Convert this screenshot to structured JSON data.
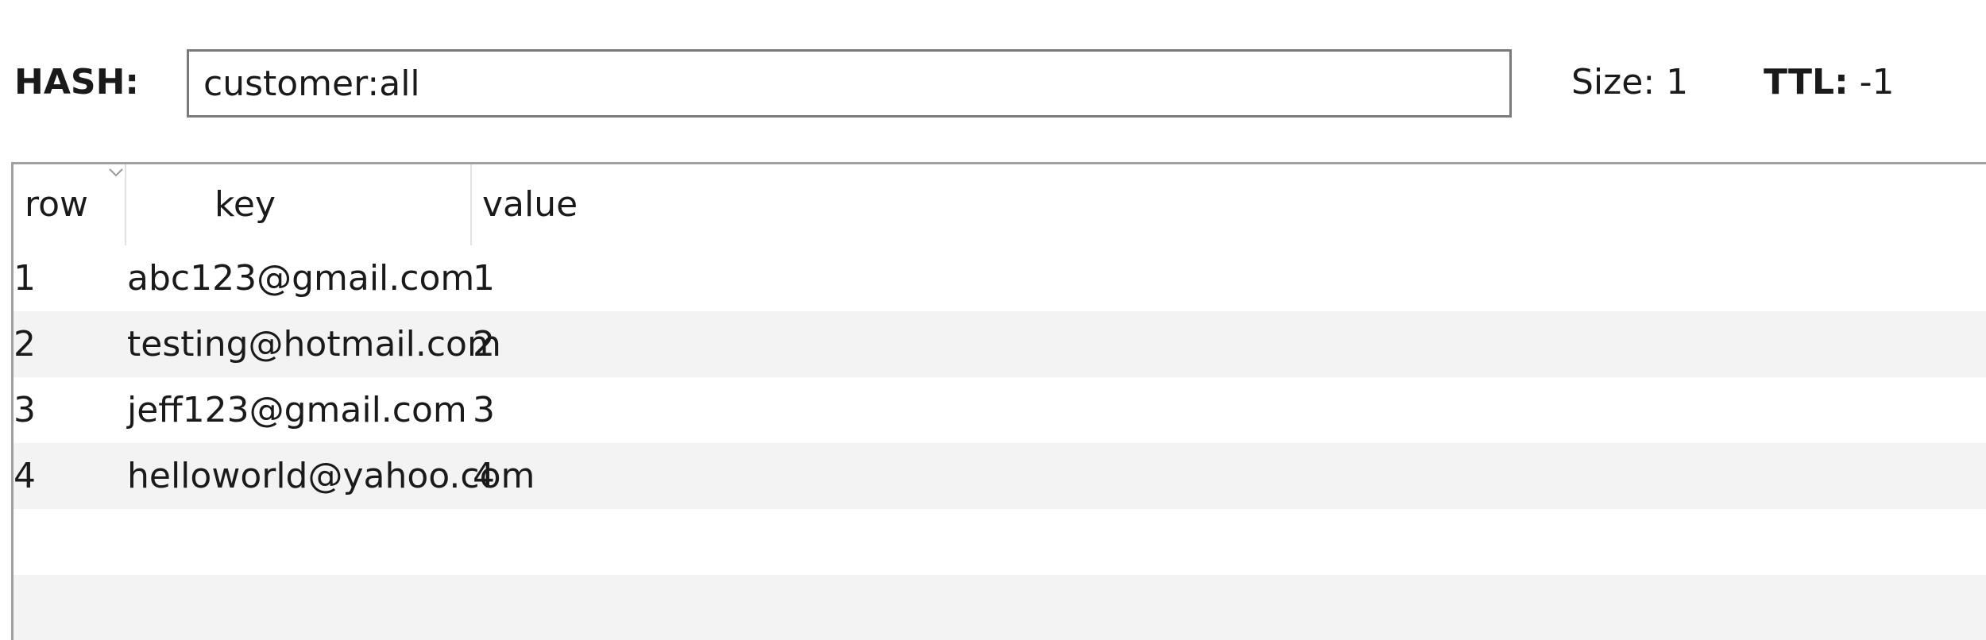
{
  "header": {
    "hash_label": "HASH:",
    "hash_value": "customer:all",
    "size_label": "Size: 1",
    "ttl_label": "TTL:",
    "ttl_value": "-1"
  },
  "table": {
    "columns": [
      "row",
      "key",
      "value"
    ],
    "sort_icon": "chevron-down-icon",
    "rows": [
      {
        "row": "1",
        "key": "abc123@gmail.com",
        "value": "1"
      },
      {
        "row": "2",
        "key": "testing@hotmail.com",
        "value": "2"
      },
      {
        "row": "3",
        "key": "jeff123@gmail.com",
        "value": "3"
      },
      {
        "row": "4",
        "key": "helloworld@yahoo.com",
        "value": "4"
      }
    ]
  },
  "colors": {
    "alt_row": "#f3f3f3",
    "border": "#a0a0a0",
    "input_border": "#7a7a7a"
  }
}
